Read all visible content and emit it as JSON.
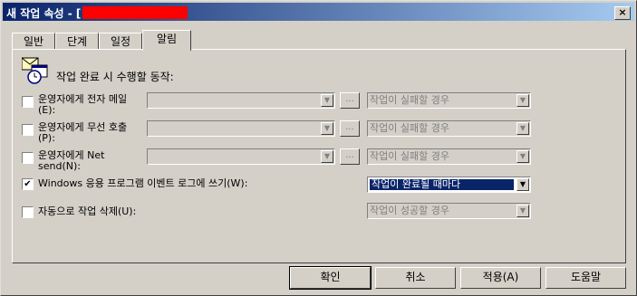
{
  "window": {
    "title": "새 작업 속성 - [",
    "close_label": "×"
  },
  "tabs": [
    {
      "label": "일반"
    },
    {
      "label": "단계"
    },
    {
      "label": "일정"
    },
    {
      "label": "알림",
      "active": true
    }
  ],
  "panel": {
    "section_title": "작업 완료 시 수행할 동작:",
    "rows": [
      {
        "label_line1": "운영자에게 전자 메일",
        "label_line2": "(E):",
        "checked": false,
        "operator": "",
        "condition": "작업이 실패할 경우",
        "condition_enabled": false,
        "has_browse": true
      },
      {
        "label_line1": "운영자에게 무선 호출",
        "label_line2": "(P):",
        "checked": false,
        "operator": "",
        "condition": "작업이 실패할 경우",
        "condition_enabled": false,
        "has_browse": true
      },
      {
        "label_line1": "운영자에게 Net",
        "label_line2": "send(N):",
        "checked": false,
        "operator": "",
        "condition": "작업이 실패할 경우",
        "condition_enabled": false,
        "has_browse": true
      },
      {
        "label_line1": "Windows 응용 프로그램 이벤트 로그에 쓰기(W):",
        "label_line2": "",
        "checked": true,
        "condition": "작업이 완료될 때마다",
        "condition_enabled": true,
        "has_browse": false
      },
      {
        "label_line1": "자동으로 작업 삭제(U):",
        "label_line2": "",
        "checked": false,
        "condition": "작업이 성공할 경우",
        "condition_enabled": false,
        "has_browse": false
      }
    ],
    "browse_label": "...",
    "check_mark": "✔",
    "dropdown_arrow": "▼"
  },
  "buttons": {
    "ok": "확인",
    "cancel": "취소",
    "apply": "적용(A)",
    "help": "도움말"
  }
}
